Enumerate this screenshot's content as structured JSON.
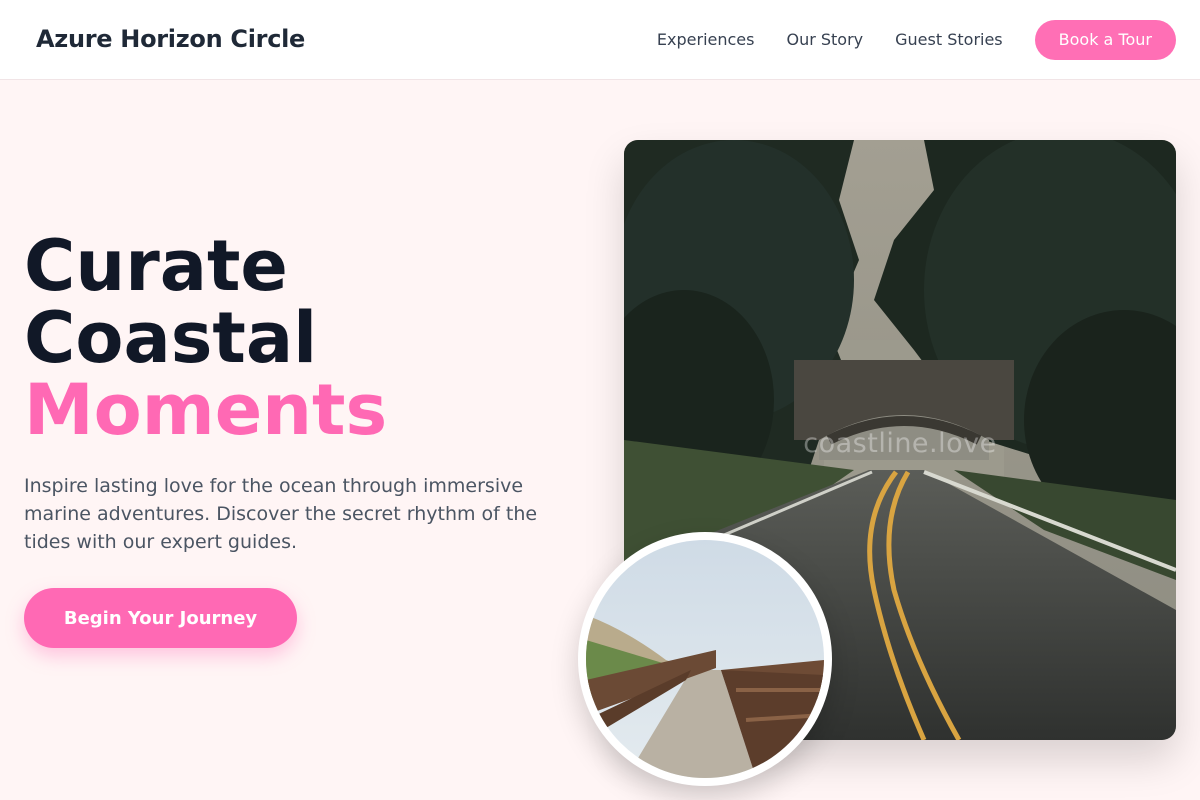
{
  "brand": {
    "name": "Azure Horizon Circle"
  },
  "nav": {
    "links": [
      "Experiences",
      "Our Story",
      "Guest Stories"
    ],
    "cta_label": "Book a Tour"
  },
  "hero": {
    "title_line1": "Curate",
    "title_line2": "Coastal",
    "title_line3": "Moments",
    "description": "Inspire lasting love for the ocean through immersive marine adventures. Discover the secret rhythm of the tides with our expert guides.",
    "button_label": "Begin Your Journey"
  },
  "images": {
    "main_watermark": "coastline.love",
    "main_subject": "forest road through stone arch bridge",
    "circle_subject": "wooden boardwalk over dunes"
  },
  "colors": {
    "accent": "#ff69b4",
    "nav_button": "#ff6fb5",
    "heading": "#111827",
    "body_text": "#4b5563",
    "background": "#fff5f5"
  }
}
